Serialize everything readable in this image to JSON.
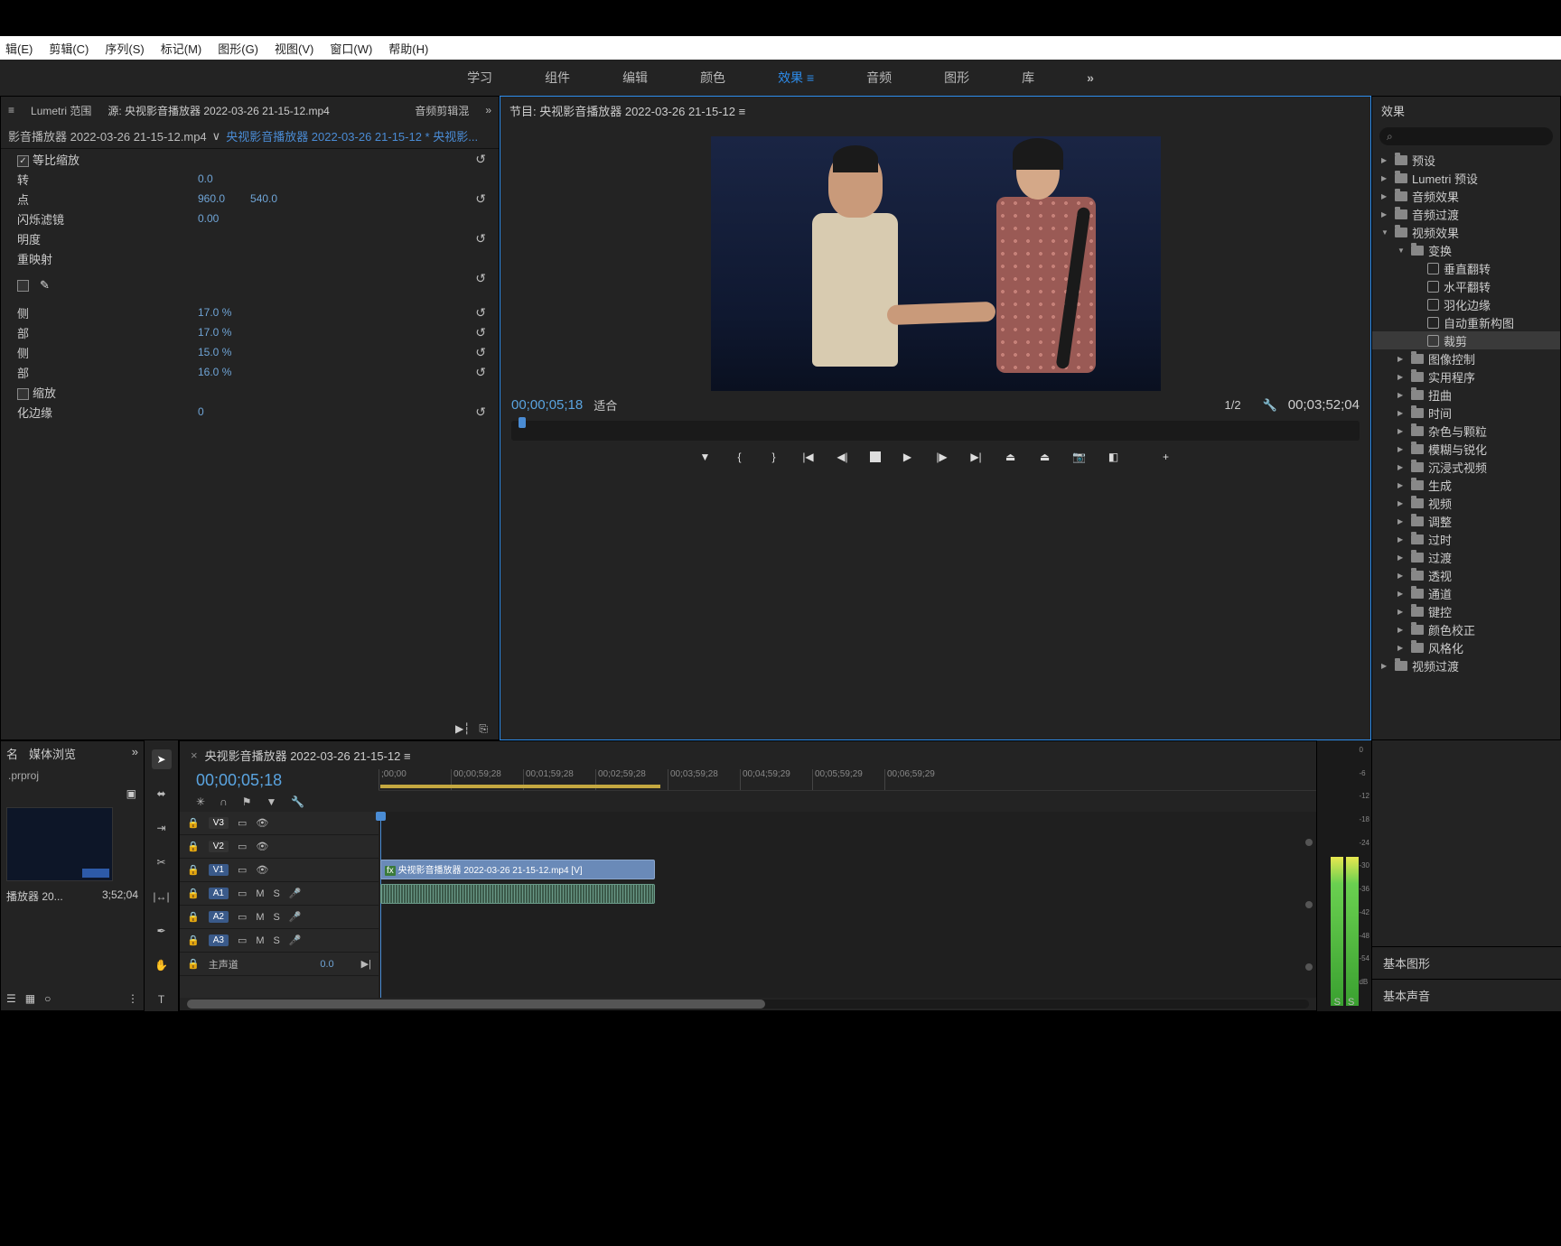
{
  "menubar": [
    "辑(E)",
    "剪辑(C)",
    "序列(S)",
    "标记(M)",
    "图形(G)",
    "视图(V)",
    "窗口(W)",
    "帮助(H)"
  ],
  "workspace": {
    "tabs": [
      "学习",
      "组件",
      "编辑",
      "颜色",
      "效果",
      "音频",
      "图形",
      "库"
    ],
    "active": "效果"
  },
  "effectControls": {
    "headerTabs": [
      "Lumetri 范围"
    ],
    "source": "源: 央视影音播放器 2022-03-26 21-15-12.mp4",
    "mix": "音频剪辑混",
    "crumbClip": "影音播放器 2022-03-26 21-15-12.mp4",
    "crumbSeq": "央视影音播放器 2022-03-26 21-15-12 * 央视影...",
    "precomps": {
      "label": "等比缩放",
      "checked": true
    },
    "rows": [
      {
        "label": "转",
        "val": "0.0"
      },
      {
        "label": "点",
        "val": "960.0",
        "val2": "540.0"
      },
      {
        "label": "闪烁滤镜",
        "val": "0.00"
      },
      {
        "label": "明度",
        "val": ""
      },
      {
        "label": "重映射",
        "val": ""
      }
    ],
    "cropRows": [
      {
        "label": "侧",
        "val": "17.0 %"
      },
      {
        "label": "部",
        "val": "17.0 %"
      },
      {
        "label": "侧",
        "val": "15.0 %"
      },
      {
        "label": "部",
        "val": "16.0 %"
      }
    ],
    "zoom": {
      "label": "缩放",
      "checked": false
    },
    "edge": {
      "label": "化边缘",
      "val": "0"
    }
  },
  "program": {
    "title": "节目: 央视影音播放器 2022-03-26 21-15-12 ≡",
    "tcLeft": "00;00;05;18",
    "fit": "适合",
    "half": "1/2",
    "tcRight": "00;03;52;04"
  },
  "effectsPanel": {
    "title": "效果",
    "searchPlaceholder": "",
    "tree": [
      {
        "t": "folder",
        "open": 0,
        "lvl": 0,
        "label": "预设"
      },
      {
        "t": "folder",
        "open": 0,
        "lvl": 0,
        "label": "Lumetri 预设"
      },
      {
        "t": "folder",
        "open": 0,
        "lvl": 0,
        "label": "音频效果"
      },
      {
        "t": "folder",
        "open": 0,
        "lvl": 0,
        "label": "音频过渡"
      },
      {
        "t": "folder",
        "open": 1,
        "lvl": 0,
        "label": "视频效果"
      },
      {
        "t": "folder",
        "open": 1,
        "lvl": 1,
        "label": "变换"
      },
      {
        "t": "preset",
        "lvl": 2,
        "label": "垂直翻转"
      },
      {
        "t": "preset",
        "lvl": 2,
        "label": "水平翻转"
      },
      {
        "t": "preset",
        "lvl": 2,
        "label": "羽化边缘"
      },
      {
        "t": "preset",
        "lvl": 2,
        "label": "自动重新构图"
      },
      {
        "t": "preset",
        "lvl": 2,
        "label": "裁剪",
        "sel": true
      },
      {
        "t": "folder",
        "open": 0,
        "lvl": 1,
        "label": "图像控制"
      },
      {
        "t": "folder",
        "open": 0,
        "lvl": 1,
        "label": "实用程序"
      },
      {
        "t": "folder",
        "open": 0,
        "lvl": 1,
        "label": "扭曲"
      },
      {
        "t": "folder",
        "open": 0,
        "lvl": 1,
        "label": "时间"
      },
      {
        "t": "folder",
        "open": 0,
        "lvl": 1,
        "label": "杂色与颗粒"
      },
      {
        "t": "folder",
        "open": 0,
        "lvl": 1,
        "label": "模糊与锐化"
      },
      {
        "t": "folder",
        "open": 0,
        "lvl": 1,
        "label": "沉浸式视频"
      },
      {
        "t": "folder",
        "open": 0,
        "lvl": 1,
        "label": "生成"
      },
      {
        "t": "folder",
        "open": 0,
        "lvl": 1,
        "label": "视频"
      },
      {
        "t": "folder",
        "open": 0,
        "lvl": 1,
        "label": "调整"
      },
      {
        "t": "folder",
        "open": 0,
        "lvl": 1,
        "label": "过时"
      },
      {
        "t": "folder",
        "open": 0,
        "lvl": 1,
        "label": "过渡"
      },
      {
        "t": "folder",
        "open": 0,
        "lvl": 1,
        "label": "透视"
      },
      {
        "t": "folder",
        "open": 0,
        "lvl": 1,
        "label": "通道"
      },
      {
        "t": "folder",
        "open": 0,
        "lvl": 1,
        "label": "键控"
      },
      {
        "t": "folder",
        "open": 0,
        "lvl": 1,
        "label": "颜色校正"
      },
      {
        "t": "folder",
        "open": 0,
        "lvl": 1,
        "label": "风格化"
      },
      {
        "t": "folder",
        "open": 0,
        "lvl": 0,
        "label": "视频过渡"
      }
    ]
  },
  "project": {
    "tabs": [
      "名",
      "媒体浏览"
    ],
    "proj": ".prproj",
    "itemName": "播放器 20...",
    "itemDur": "3;52;04"
  },
  "timeline": {
    "seqName": "央视影音播放器 2022-03-26 21-15-12 ≡",
    "tc": "00;00;05;18",
    "ruler": [
      ";00;00",
      "00;00;59;28",
      "00;01;59;28",
      "00;02;59;28",
      "00;03;59;28",
      "00;04;59;29",
      "00;05;59;29",
      "00;06;59;29"
    ],
    "videoTracks": [
      "V3",
      "V2",
      "V1"
    ],
    "audioTracks": [
      "A1",
      "A2",
      "A3"
    ],
    "master": {
      "label": "主声道",
      "val": "0.0"
    },
    "clipName": "央视影音播放器 2022-03-26 21-15-12.mp4 [V]"
  },
  "meterScale": [
    "0",
    "-6",
    "-12",
    "-18",
    "-24",
    "-30",
    "-36",
    "-42",
    "-48",
    "-54",
    "dB"
  ],
  "meterSolo": [
    "S",
    "S"
  ],
  "rightBottom": [
    "基本图形",
    "基本声音"
  ]
}
